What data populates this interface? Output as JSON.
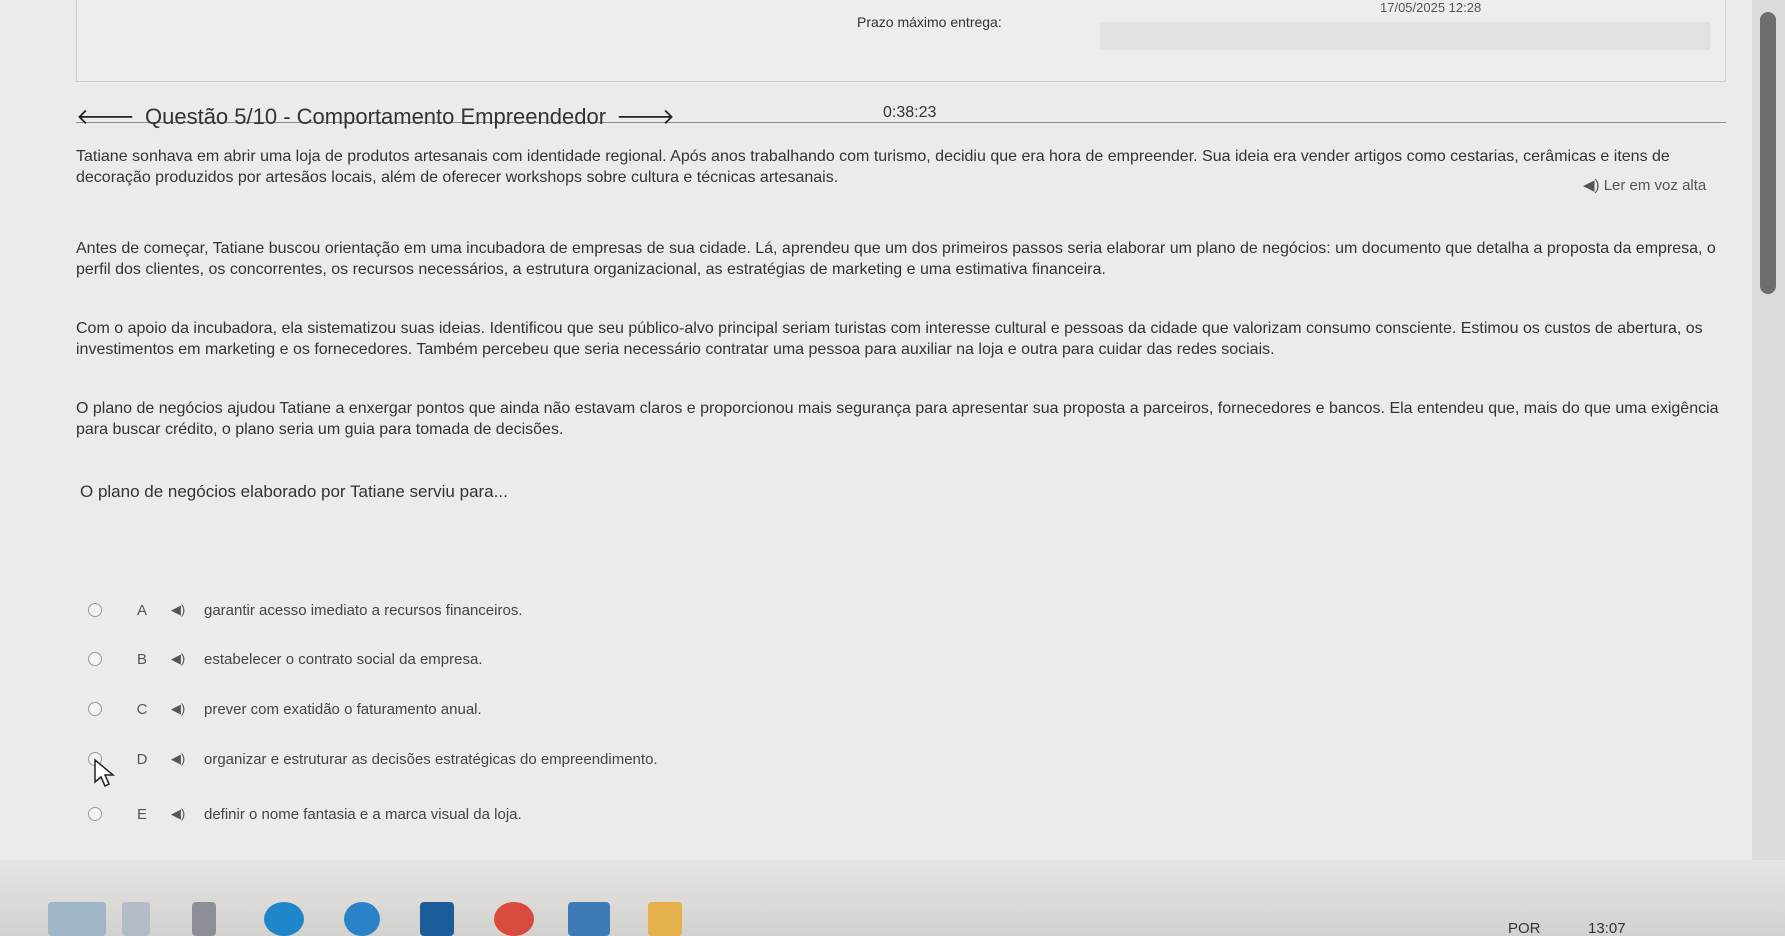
{
  "header": {
    "date_time": "17/05/2025 12:28",
    "deadline_label": "Prazo máximo entrega:",
    "timer": "0:38:23"
  },
  "question": {
    "title": "Questão 5/10 - Comportamento Empreendedor",
    "read_aloud_label": "Ler em voz alta",
    "paragraphs": [
      "Tatiane sonhava em abrir uma loja de produtos artesanais com identidade regional. Após anos trabalhando com turismo, decidiu que era hora de empreender. Sua ideia era vender artigos como cestarias, cerâmicas e itens de decoração produzidos por artesãos locais, além de oferecer workshops sobre cultura e técnicas artesanais.",
      "Antes de começar, Tatiane buscou orientação em uma incubadora de empresas de sua cidade. Lá, aprendeu que um dos primeiros passos seria elaborar um plano de negócios: um documento que detalha a proposta da empresa, o perfil dos clientes, os concorrentes, os recursos necessários, a estrutura organizacional, as estratégias de marketing e uma estimativa financeira.",
      "Com o apoio da incubadora, ela sistematizou suas ideias. Identificou que seu público-alvo principal seriam turistas com interesse cultural e pessoas da cidade que valorizam consumo consciente. Estimou os custos de abertura, os investimentos em marketing e os fornecedores. Também percebeu que seria necessário contratar uma pessoa para auxiliar na loja e outra para cuidar das redes sociais.",
      "O plano de negócios ajudou Tatiane a enxergar pontos que ainda não estavam claros e proporcionou mais segurança para apresentar sua proposta a parceiros, fornecedores e bancos. Ela entendeu que, mais do que uma exigência para buscar crédito, o plano seria um guia para tomada de decisões."
    ],
    "prompt": "O plano de negócios elaborado por Tatiane serviu para...",
    "options": [
      {
        "letter": "A",
        "text": "garantir acesso imediato a recursos financeiros."
      },
      {
        "letter": "B",
        "text": "estabelecer o contrato social da empresa."
      },
      {
        "letter": "C",
        "text": "prever com exatidão o faturamento anual."
      },
      {
        "letter": "D",
        "text": "organizar e estruturar as decisões estratégicas do empreendimento."
      },
      {
        "letter": "E",
        "text": "definir o nome fantasia e a marca visual da loja."
      }
    ]
  },
  "taskbar": {
    "language": "POR",
    "time": "13:07"
  },
  "colors": {
    "background": "#ecebe8",
    "text": "#333333",
    "taskbar": "#d2d1ce",
    "scrollbar_thumb": "#6f6e6b"
  }
}
